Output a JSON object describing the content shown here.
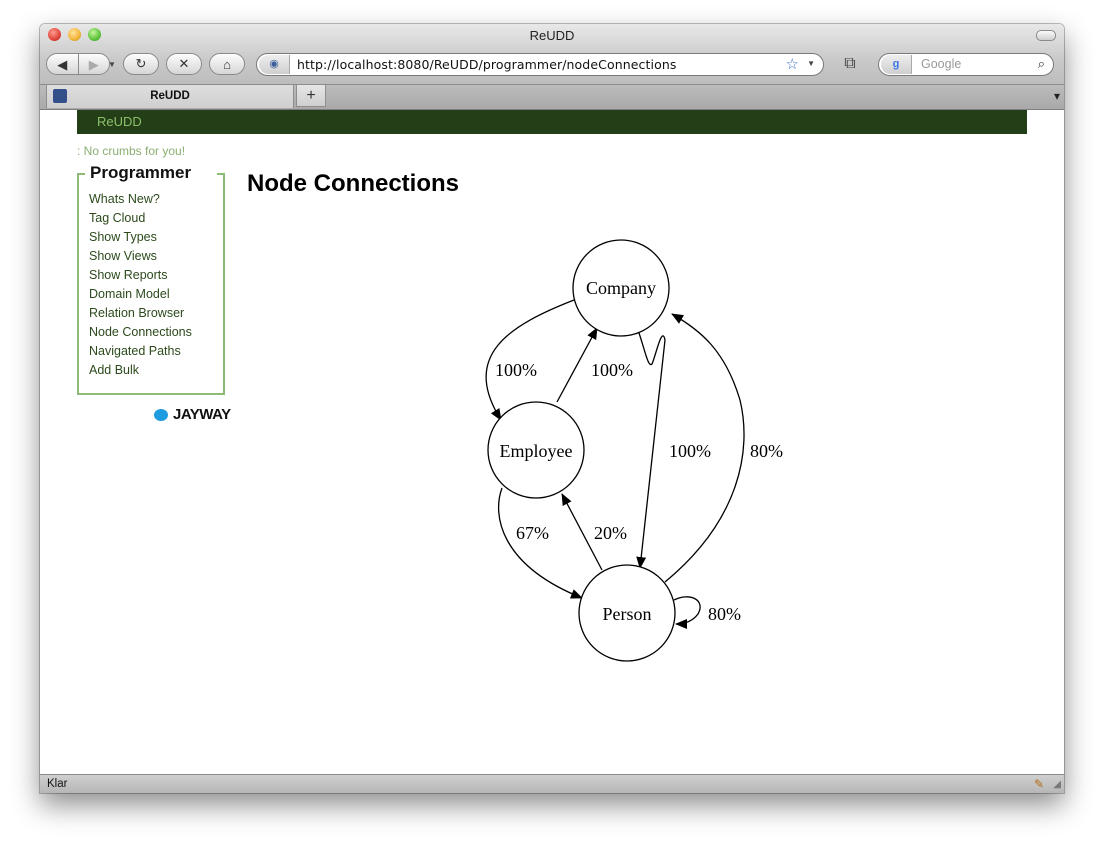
{
  "window": {
    "title": "ReUDD"
  },
  "toolbar": {
    "back_glyph": "◀",
    "forward_glyph": "▶",
    "reload_glyph": "↻",
    "stop_glyph": "✕",
    "home_glyph": "⌂",
    "url": "http://localhost:8080/ReUDD/programmer/nodeConnections",
    "search_placeholder": "Google",
    "search_engine_glyph": "g"
  },
  "tabs": [
    {
      "label": "ReUDD"
    }
  ],
  "new_tab_glyph": "+",
  "site": {
    "brand": "ReUDD",
    "breadcrumb": ": No crumbs for you!",
    "sidebar": {
      "title": "Programmer",
      "items": [
        "Whats New?",
        "Tag Cloud",
        "Show Types",
        "Show Views",
        "Show Reports",
        "Domain Model",
        "Relation Browser",
        "Node Connections",
        "Navigated Paths",
        "Add Bulk"
      ]
    },
    "logo_text": "JAYWAY",
    "page_title": "Node Connections"
  },
  "graph": {
    "nodes": [
      {
        "id": "company",
        "label": "Company"
      },
      {
        "id": "employee",
        "label": "Employee"
      },
      {
        "id": "person",
        "label": "Person"
      }
    ],
    "edges": [
      {
        "from": "company",
        "to": "employee",
        "label": "100%"
      },
      {
        "from": "employee",
        "to": "company",
        "label": "100%"
      },
      {
        "from": "company",
        "to": "person",
        "label": "100%"
      },
      {
        "from": "person",
        "to": "company",
        "label": "80%"
      },
      {
        "from": "employee",
        "to": "person",
        "label": "67%"
      },
      {
        "from": "person",
        "to": "employee",
        "label": "20%"
      },
      {
        "from": "person",
        "to": "person",
        "label": "80%"
      }
    ]
  },
  "status_bar": {
    "text": "Klar"
  },
  "colors": {
    "topbar": "#243f17",
    "brand_text": "#8cbf6a",
    "sidebar_border": "#8dbb74",
    "nav_link": "#2c4a1c",
    "logo_bird": "#1f9be0"
  }
}
